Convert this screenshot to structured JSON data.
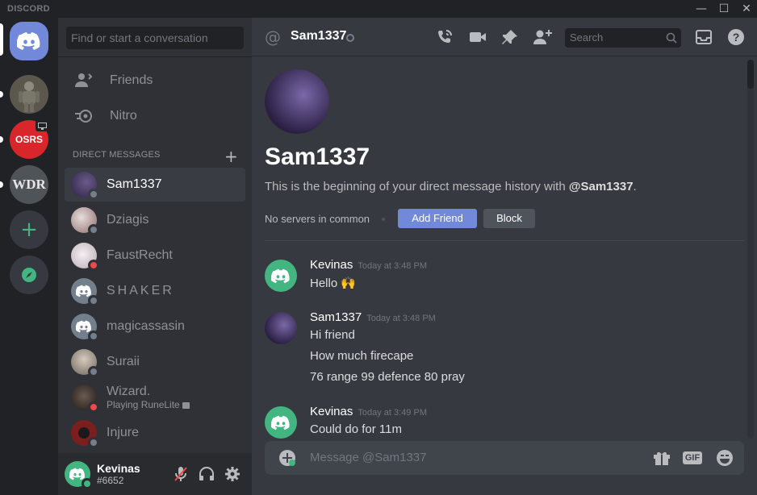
{
  "app": {
    "brand": "DISCORD"
  },
  "window_controls": [
    "—",
    "☐",
    "✕"
  ],
  "guilds": [
    {
      "name": "Home",
      "icon": "discord-logo-icon"
    },
    {
      "name": "Server 1"
    },
    {
      "name": "OSRS Lietuva",
      "text": "OSRS"
    },
    {
      "name": "WDR",
      "text": "WDR"
    },
    {
      "name": "Add a Server",
      "icon": "plus-icon"
    },
    {
      "name": "Explore",
      "icon": "compass-icon"
    }
  ],
  "dm_sidebar": {
    "search_placeholder": "Find or start a conversation",
    "nav": [
      {
        "label": "Friends",
        "icon": "friends-icon"
      },
      {
        "label": "Nitro",
        "icon": "nitro-icon"
      }
    ],
    "header": "DIRECT MESSAGES",
    "items": [
      {
        "name": "Sam1337",
        "status": "offline",
        "color": "#3d2f5a",
        "active": true
      },
      {
        "name": "Dziagis",
        "status": "offline",
        "color": "#c9b8c4"
      },
      {
        "name": "FaustRecht",
        "status": "dnd",
        "color": "#e8e1e6"
      },
      {
        "name": "SHAKER",
        "status": "offline",
        "color": "#747f8d"
      },
      {
        "name": "magicassasin",
        "status": "offline",
        "color": "#747f8d"
      },
      {
        "name": "Suraii",
        "status": "offline",
        "color": "#b5a99b"
      },
      {
        "name": "Wizard.",
        "sub": "Playing RuneLite",
        "status": "dnd",
        "color": "#3a2f2b"
      },
      {
        "name": "Injure",
        "status": "offline",
        "color": "#7a1e1e"
      }
    ]
  },
  "user_panel": {
    "username": "Kevinas",
    "tag": "#6652",
    "status": "online"
  },
  "header": {
    "channel": "Sam1337",
    "search_placeholder": "Search"
  },
  "intro": {
    "name": "Sam1337",
    "sub_prefix": "This is the beginning of your direct message history with ",
    "sub_user": "@Sam1337",
    "sub_suffix": ".",
    "common": "No servers in common",
    "add_friend": "Add Friend",
    "block": "Block"
  },
  "messages": [
    {
      "author": "Kevinas",
      "time": "Today at 3:48 PM",
      "avatar": "discord",
      "lines": [
        "Hello 🙌"
      ]
    },
    {
      "author": "Sam1337",
      "time": "Today at 3:48 PM",
      "avatar": "photo",
      "lines": [
        "Hi friend",
        "How much firecape",
        "76 range 99 defence 80 pray"
      ]
    },
    {
      "author": "Kevinas",
      "time": "Today at 3:49 PM",
      "avatar": "discord",
      "lines": [
        "Could do for 11m"
      ]
    }
  ],
  "composer": {
    "placeholder": "Message @Sam1337",
    "gif_label": "GIF"
  },
  "colors": {
    "blurple": "#7289da",
    "green": "#43b581",
    "dnd": "#f04747",
    "offline": "#747f8d"
  }
}
